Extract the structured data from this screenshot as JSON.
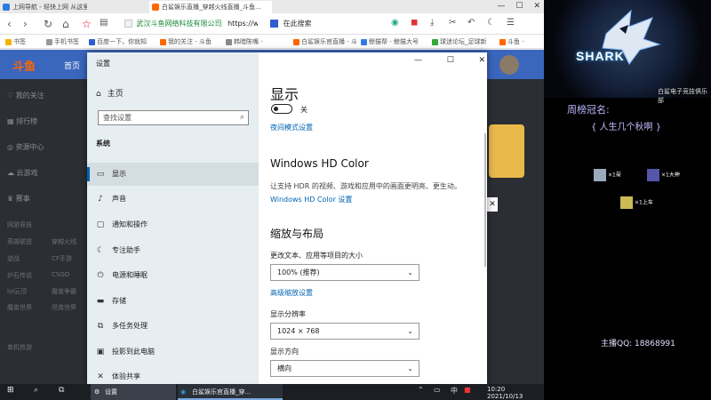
{
  "browser": {
    "tabs": [
      {
        "label": "上网导航 - 轻快上网 从这里开始"
      },
      {
        "label": "白鲨娱乐直播_穿越火线直播_斗鱼..."
      }
    ],
    "url": "https://ww",
    "site_identity": "武汉斗鱼网络科技有限公司",
    "search_placeholder": "在此搜索",
    "window_controls": [
      "—",
      "☐",
      "✕"
    ],
    "bookmarks": [
      "书签",
      "手机书签",
      "百度一下，你就知",
      "我的关注 - 斗鱼",
      "韩暗陈嘴 -",
      "白鲨娱乐官直播 - 斗",
      "鲸猫帮 - 鲸猫大号",
      "球迷论坛_足球新",
      "斗鱼 -"
    ]
  },
  "douyu": {
    "logo": "斗鱼",
    "home": "首页",
    "sidebar": [
      {
        "label": "我的关注",
        "icon": "heart-icon"
      },
      {
        "label": "排行榜",
        "icon": "rank-icon"
      },
      {
        "label": "资源中心",
        "icon": "resource-icon"
      },
      {
        "label": "云游戏",
        "icon": "cloud-game-icon"
      },
      {
        "label": "赛事",
        "icon": "trophy-icon"
      }
    ],
    "group_label": "网游竞技",
    "games": [
      "英雄联盟",
      "穿越火线",
      "逆战",
      "CF手游",
      "炉石传说",
      "CSGO",
      "lol云顶",
      "魔兽争霸",
      "魔兽世界",
      "坦克世界"
    ],
    "group2": "单机热游"
  },
  "settings": {
    "window_title": "设置",
    "window_controls": [
      "—",
      "☐",
      "✕"
    ],
    "home": "主页",
    "search_placeholder": "查找设置",
    "group": "系统",
    "nav": [
      {
        "label": "显示",
        "icon": "monitor-icon",
        "selected": true
      },
      {
        "label": "声音",
        "icon": "speaker-icon"
      },
      {
        "label": "通知和操作",
        "icon": "notification-icon"
      },
      {
        "label": "专注助手",
        "icon": "moon-icon"
      },
      {
        "label": "电源和睡眠",
        "icon": "power-icon"
      },
      {
        "label": "存储",
        "icon": "storage-icon"
      },
      {
        "label": "多任务处理",
        "icon": "multitask-icon"
      },
      {
        "label": "投影到此电脑",
        "icon": "project-icon"
      },
      {
        "label": "体验共享",
        "icon": "share-icon"
      }
    ],
    "content": {
      "heading": "显示",
      "night_light_state": "关",
      "night_light_link": "夜间模式设置",
      "hdr_heading": "Windows HD Color",
      "hdr_desc": "让支持 HDR 的视频、游戏和应用中的画面更明亮、更生动。",
      "hdr_link": "Windows HD Color 设置",
      "scale_heading": "缩放与布局",
      "scale_label": "更改文本、应用等项目的大小",
      "scale_value": "100% (推荐)",
      "advanced_link": "高级缩放设置",
      "resolution_label": "显示分辨率",
      "resolution_value": "1024 × 768",
      "orientation_label": "显示方向",
      "orientation_value": "横向"
    }
  },
  "taskbar": {
    "apps": [
      "设置",
      "白鲨娱乐官直播_穿..."
    ],
    "ime": "中",
    "time": "10:20",
    "date": "2021/10/13"
  },
  "overlay": {
    "team_name": "SHARK",
    "club_name": "白鲨电子竞技俱乐部",
    "weekly_title": "周榜冠名:",
    "weekly_name": "{ 人生几个秋啊 }",
    "gifts": [
      "×1荷",
      "×1大神",
      "×1上车"
    ],
    "qq_label": "主播QQ: 18868991"
  },
  "colors": {
    "douyu_nav": "#3a66bd",
    "douyu_bg": "#2b2e33",
    "settings_nav_bg": "#e7eef1",
    "accent": "#0063b1"
  }
}
